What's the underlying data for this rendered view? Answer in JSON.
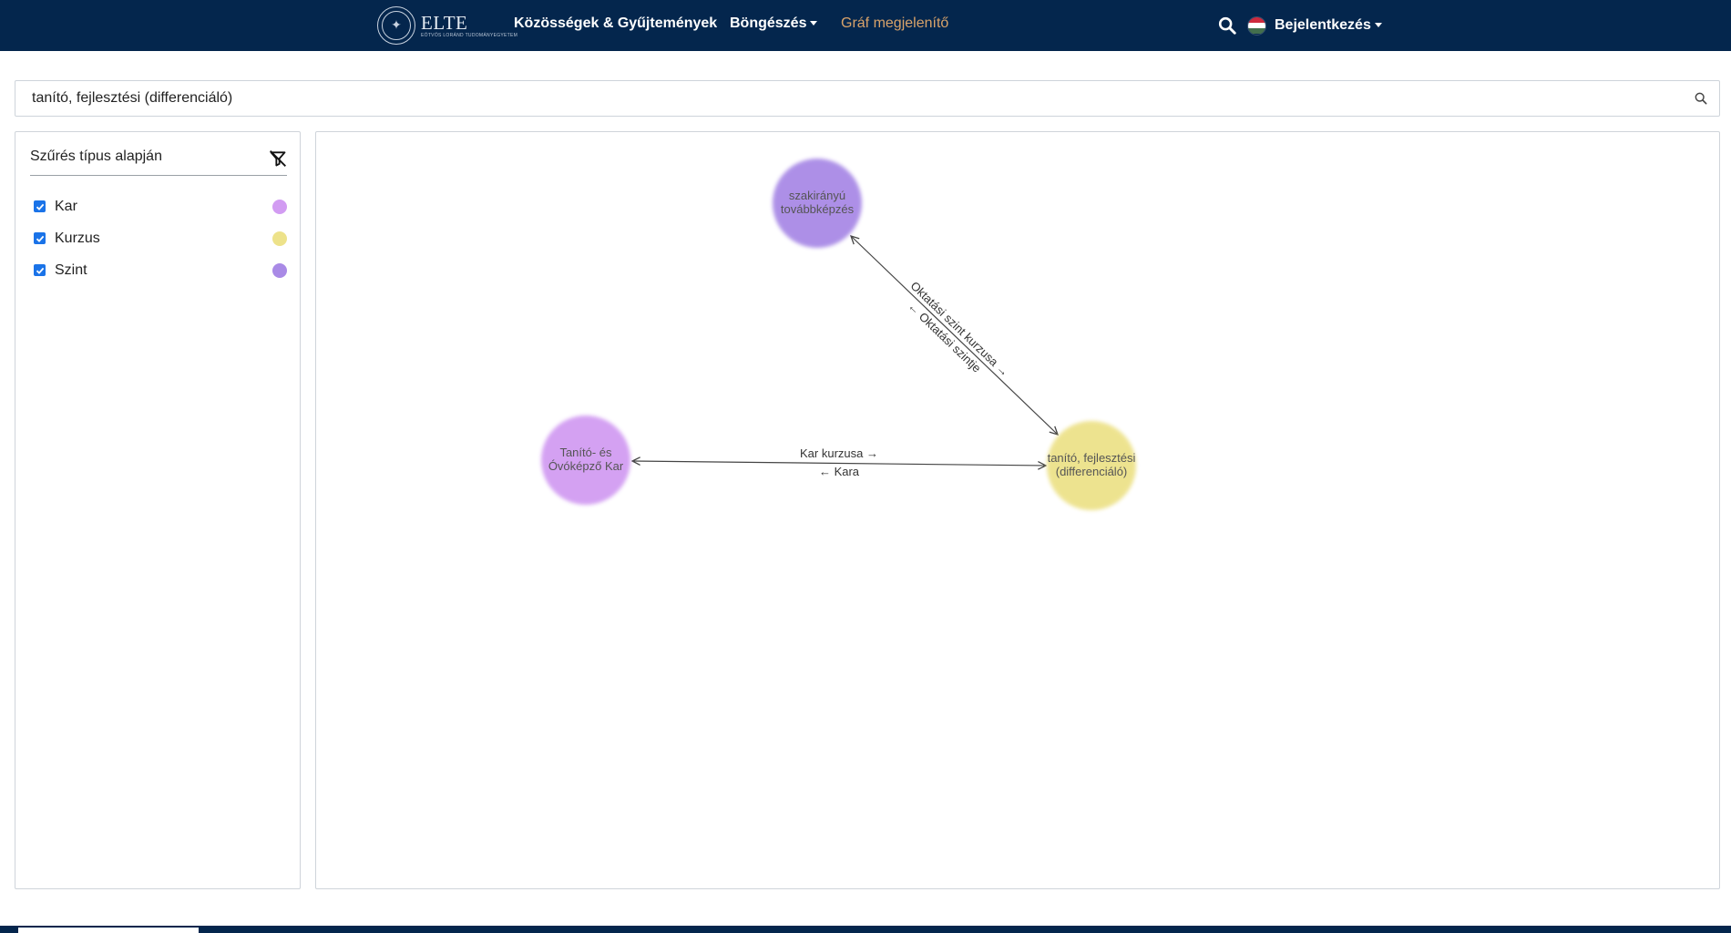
{
  "nav": {
    "logo_text": "ELTE",
    "logo_sub": "EÖTVÖS LORÁND TUDOMÁNYEGYETEM",
    "links": [
      {
        "label": "Közösségek & Gyűjtemények",
        "dropdown": false,
        "active": false
      },
      {
        "label": "Böngészés",
        "dropdown": true,
        "active": false
      },
      {
        "label": "Gráf megjelenítő",
        "dropdown": false,
        "active": true
      }
    ],
    "login_label": "Bejelentkezés",
    "icons": {
      "search": "search-icon",
      "language": "hungarian-flag-icon"
    },
    "colors": {
      "background": "#04264d",
      "active_link": "#d9a36a"
    }
  },
  "search": {
    "value": "tanító, fejlesztési (differenciáló)",
    "icon": "search-icon"
  },
  "filter": {
    "title": "Szűrés típus alapján",
    "clear_icon": "filter-clear-icon",
    "items": [
      {
        "label": "Kar",
        "checked": true,
        "color": "#d29cf2"
      },
      {
        "label": "Kurzus",
        "checked": true,
        "color": "#ede28a"
      },
      {
        "label": "Szint",
        "checked": true,
        "color": "#a98ae6"
      }
    ]
  },
  "graph": {
    "nodes": [
      {
        "id": "szint",
        "type": "Szint",
        "lines": [
          "szakirányú",
          "továbbképzés"
        ],
        "color": "#a98ae6"
      },
      {
        "id": "kar",
        "type": "Kar",
        "lines": [
          "Tanító- és",
          "Óvóképző Kar"
        ],
        "color": "#d29cf2"
      },
      {
        "id": "kurzus",
        "type": "Kurzus",
        "lines": [
          "tanító, fejlesztési",
          "(differenciáló)"
        ],
        "color": "#ede28a"
      }
    ],
    "edges": [
      {
        "from": "szint",
        "to": "kurzus",
        "forward_label": "Oktatási szint kurzusa →",
        "backward_label": "← Oktatási szintje"
      },
      {
        "from": "kar",
        "to": "kurzus",
        "forward_label": "Kar kurzusa →",
        "backward_label": "← Kara"
      }
    ]
  }
}
